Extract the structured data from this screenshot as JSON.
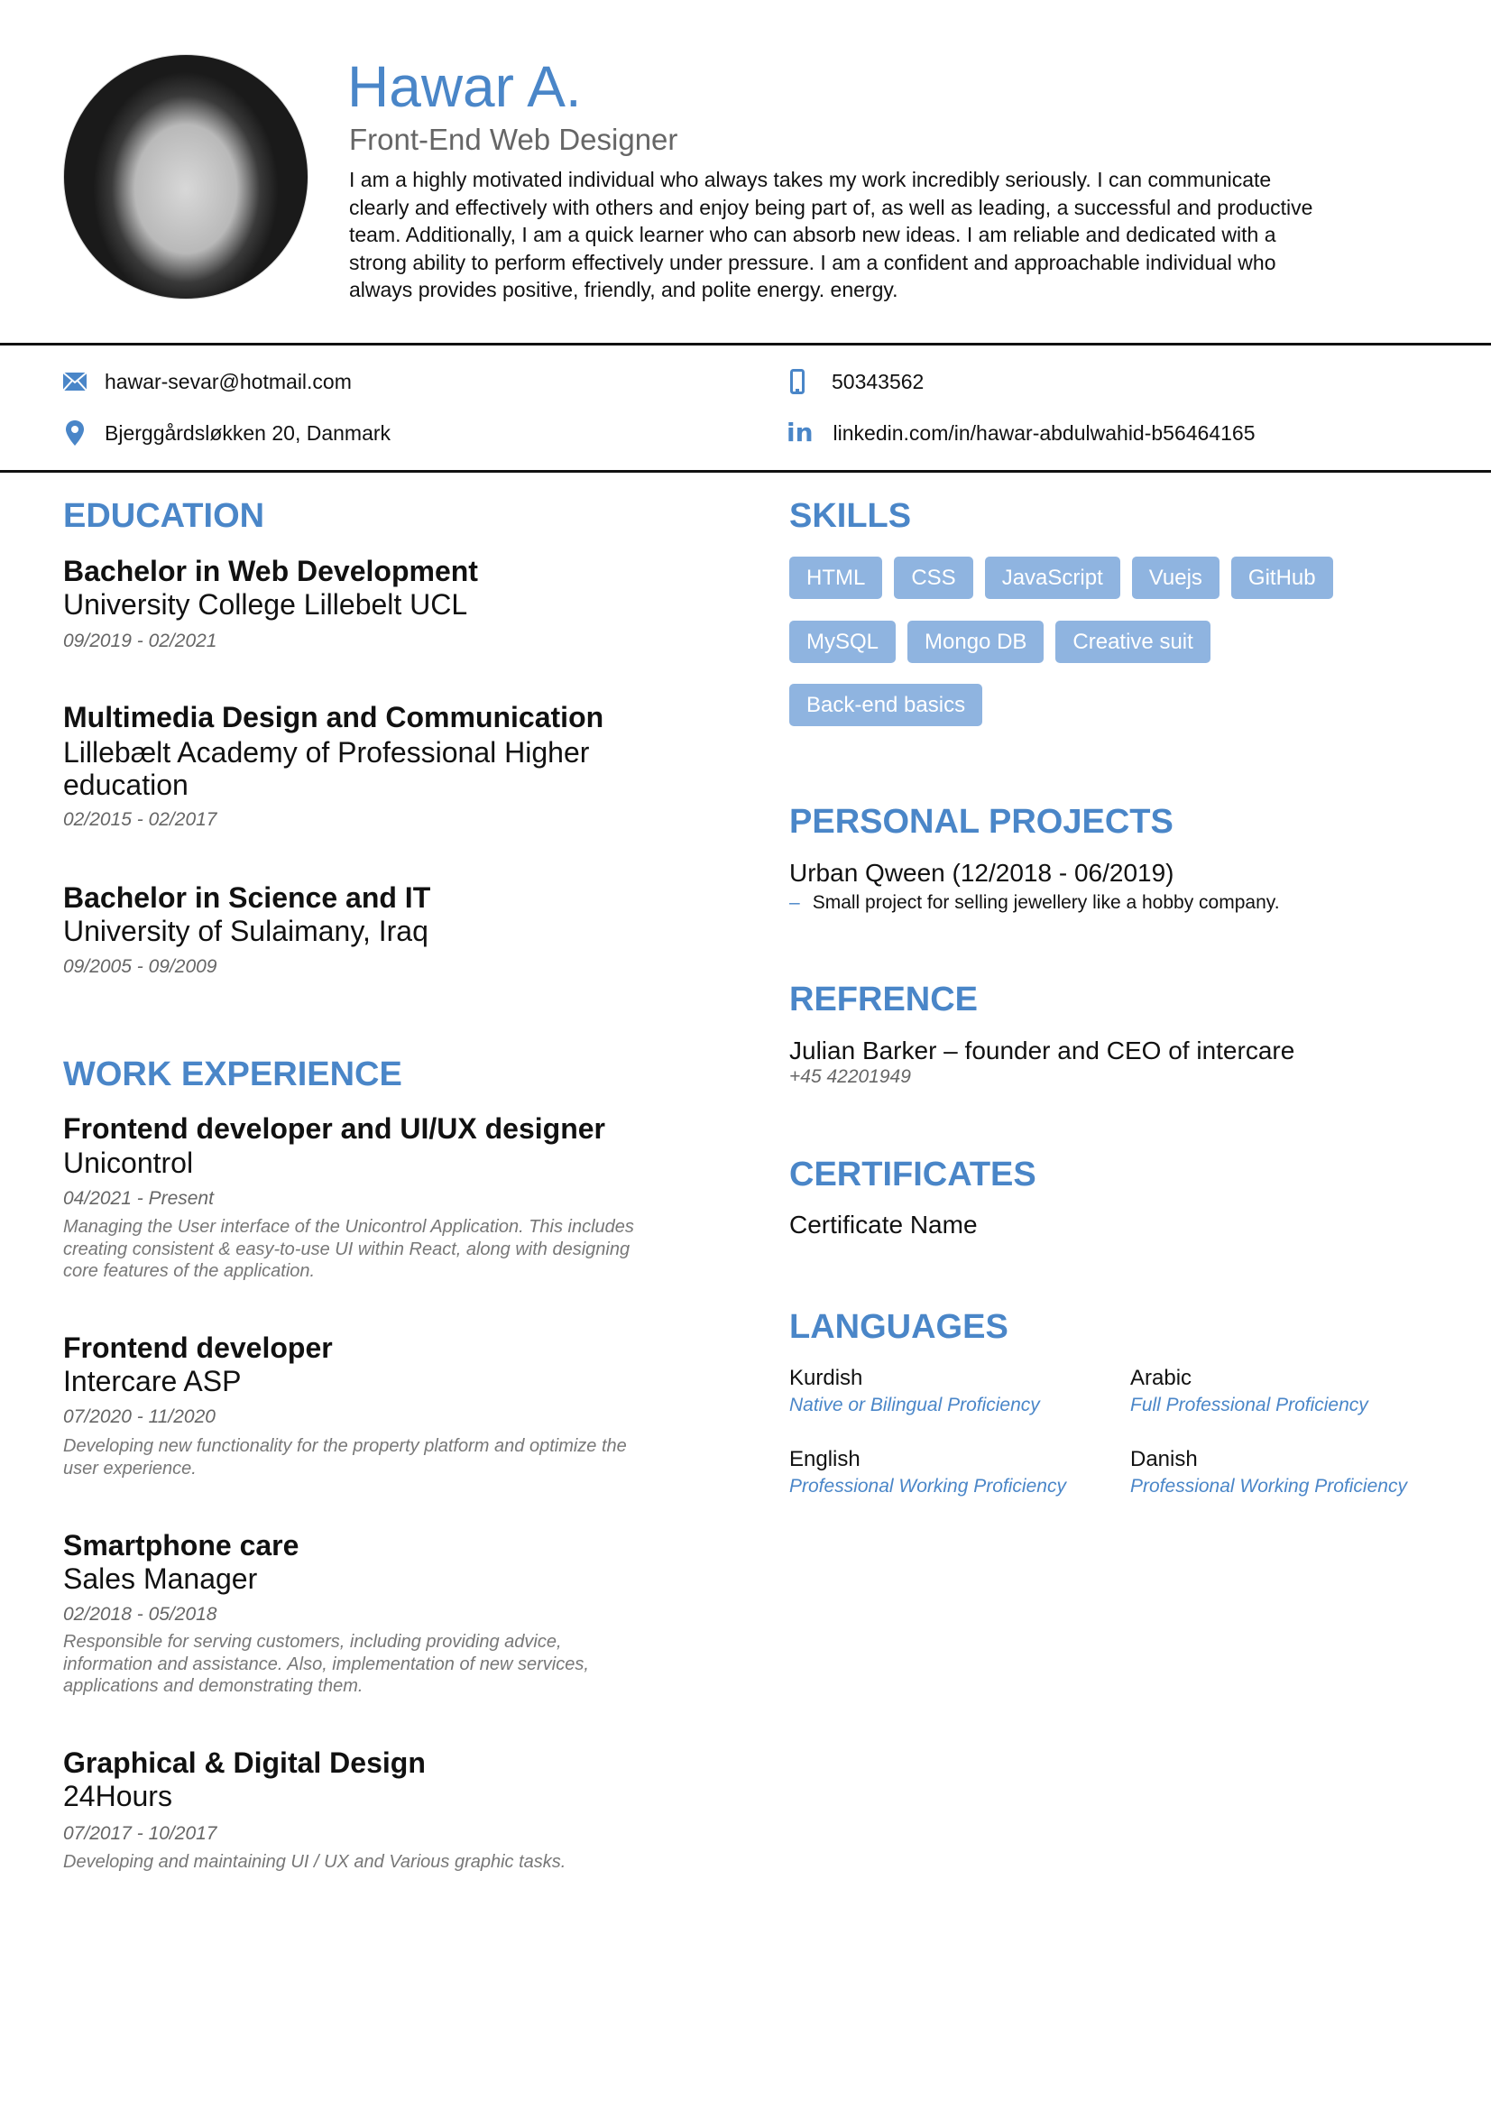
{
  "header": {
    "name": "Hawar A.",
    "role": "Front-End Web Designer",
    "summary_lines": [
      "I am a highly motivated individual who always takes my work incredibly seriously. I can communicate",
      "clearly and effectively with others and enjoy being part of, as well as leading, a successful and productive",
      "team. Additionally, I am a quick learner who can absorb new ideas. I am reliable and dedicated with a",
      "strong ability to perform effectively under pressure. I am a confident and approachable individual who",
      "always provides positive, friendly, and polite energy. energy."
    ]
  },
  "contact": {
    "email": "hawar-sevar@hotmail.com",
    "phone": "50343562",
    "address": "Bjerggårdsløkken 20, Danmark",
    "linkedin": "linkedin.com/in/hawar-abdulwahid-b56464165"
  },
  "colors": {
    "accent": "#4a86c8",
    "tag_bg": "#8fb4e0"
  },
  "education": {
    "heading": "EDUCATION",
    "items": [
      {
        "title": "Bachelor in Web Development",
        "school_lines": [
          "University College Lillebelt UCL"
        ],
        "dates": "09/2019 - 02/2021"
      },
      {
        "title": "Multimedia Design and Communication",
        "school_lines": [
          "Lillebælt Academy of Professional Higher",
          "education"
        ],
        "dates": "02/2015 - 02/2017"
      },
      {
        "title": "Bachelor in Science and IT",
        "school_lines": [
          "University of Sulaimany, Iraq"
        ],
        "dates": "09/2005 - 09/2009"
      }
    ]
  },
  "work": {
    "heading": "WORK EXPERIENCE",
    "items": [
      {
        "title": "Frontend developer and UI/UX designer",
        "company": "Unicontrol",
        "dates": "04/2021 - Present",
        "desc_lines": [
          "Managing the User interface of the Unicontrol Application. This includes",
          "creating consistent & easy-to-use UI within React, along with designing",
          "core features of the application."
        ]
      },
      {
        "title": "Frontend developer",
        "company": "Intercare ASP",
        "dates": "07/2020 - 11/2020",
        "desc_lines": [
          "Developing new functionality for the property platform and optimize the",
          "user experience."
        ]
      },
      {
        "title": "Smartphone care",
        "company": "Sales Manager",
        "dates": "02/2018 - 05/2018",
        "desc_lines": [
          "Responsible for serving customers, including providing advice,",
          "information and assistance. Also, implementation of new services,",
          "applications and demonstrating them."
        ]
      },
      {
        "title": "Graphical & Digital Design",
        "company": "24Hours",
        "dates": "07/2017 - 10/2017",
        "desc_lines": [
          "Developing and maintaining UI / UX and Various graphic tasks."
        ]
      }
    ]
  },
  "skills": {
    "heading": "SKILLS",
    "tags": [
      "HTML",
      "CSS",
      "JavaScript",
      "Vuejs",
      "GitHub",
      "MySQL",
      "Mongo DB",
      "Creative suit",
      "Back-end basics"
    ]
  },
  "projects": {
    "heading": "PERSONAL PROJECTS",
    "items": [
      {
        "title": "Urban Qween (12/2018 - 06/2019)",
        "bullet": "Small project for selling jewellery like a hobby company."
      }
    ]
  },
  "reference": {
    "heading": "REFRENCE",
    "name": "Julian Barker – founder and CEO of intercare",
    "phone": "+45 42201949"
  },
  "certificates": {
    "heading": "CERTIFICATES",
    "items": [
      "Certificate Name"
    ]
  },
  "languages": {
    "heading": "LANGUAGES",
    "items": [
      {
        "name": "Kurdish",
        "level": "Native or Bilingual Proficiency"
      },
      {
        "name": "Arabic",
        "level": "Full Professional Proficiency"
      },
      {
        "name": "English",
        "level": "Professional Working Proficiency"
      },
      {
        "name": "Danish",
        "level": "Professional Working Proficiency"
      }
    ]
  }
}
